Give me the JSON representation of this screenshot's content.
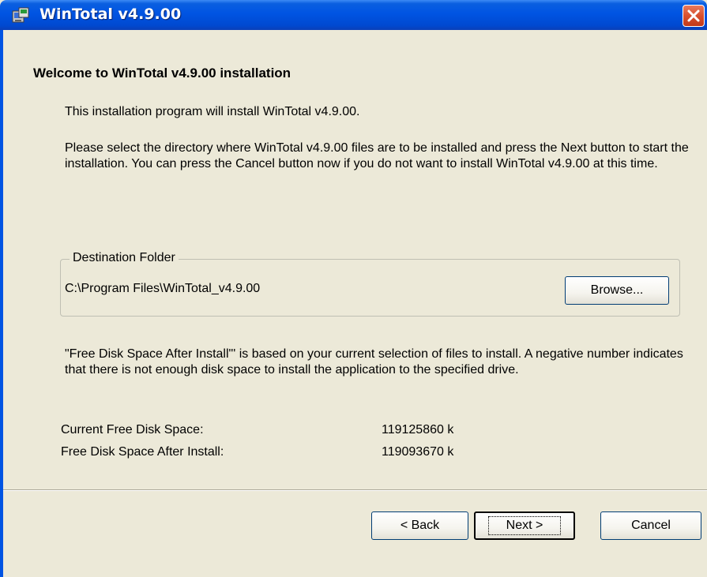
{
  "window": {
    "title": "WinTotal v4.9.00",
    "icon": "installer-icon",
    "close_icon": "close-icon"
  },
  "main": {
    "heading": "Welcome to WinTotal v4.9.00 installation",
    "intro": "This installation program will install WinTotal v4.9.00.",
    "instructions": "Please select the directory where WinTotal v4.9.00 files are to be installed and press the Next button to start the installation. You can press the Cancel button now if you do not want to install WinTotal v4.9.00 at this time.",
    "destination": {
      "legend": "Destination Folder",
      "path": "C:\\Program Files\\WinTotal_v4.9.00",
      "browse_label": "Browse..."
    },
    "disk_note": "\"Free Disk Space After Install\"' is based on your current selection of files to install.  A negative number indicates that there is not enough disk space to install the application to the specified drive.",
    "disk_info": {
      "current_label": "Current Free Disk Space:",
      "current_value": "119125860 k",
      "after_label": "Free Disk Space After Install:",
      "after_value": "119093670 k"
    }
  },
  "buttons": {
    "back_label": "< Back",
    "next_label": "Next >",
    "cancel_label": "Cancel"
  },
  "colors": {
    "titlebar": "#0054e3",
    "close_button": "#d8502f",
    "dialog_background": "#ece9d8"
  }
}
